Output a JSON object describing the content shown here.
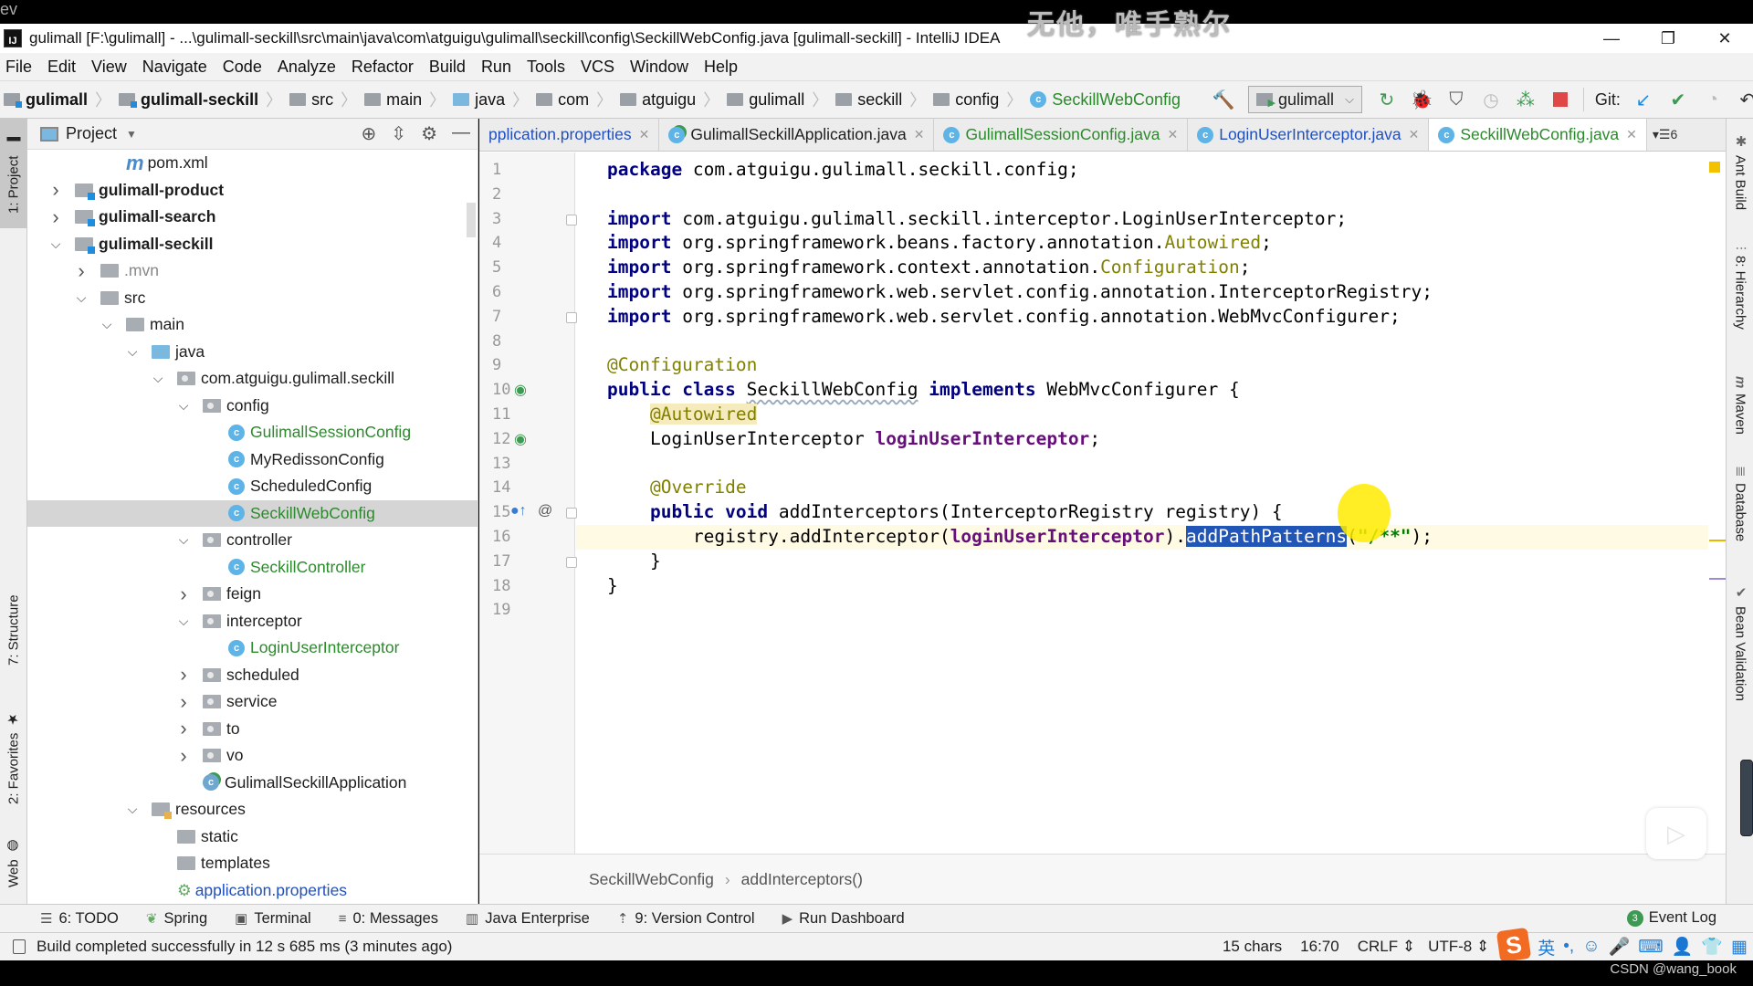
{
  "overlay": {
    "corner_text": "ev",
    "watermark": "无他，唯手熟尔",
    "credit": "CSDN @wang_book"
  },
  "window": {
    "app_icon": "IJ",
    "title": "gulimall [F:\\gulimall] - ...\\gulimall-seckill\\src\\main\\java\\com\\atguigu\\gulimall\\seckill\\config\\SeckillWebConfig.java [gulimall-seckill] - IntelliJ IDEA",
    "controls": {
      "minimize": "—",
      "restore": "❐",
      "close": "✕"
    }
  },
  "menu": [
    "File",
    "Edit",
    "View",
    "Navigate",
    "Code",
    "Analyze",
    "Refactor",
    "Build",
    "Run",
    "Tools",
    "VCS",
    "Window",
    "Help"
  ],
  "navbar": {
    "crumbs": [
      {
        "label": "gulimall",
        "icon": "module-folder",
        "bold": true
      },
      {
        "label": "gulimall-seckill",
        "icon": "module-folder",
        "bold": true
      },
      {
        "label": "src",
        "icon": "folder"
      },
      {
        "label": "main",
        "icon": "folder"
      },
      {
        "label": "java",
        "icon": "source-folder"
      },
      {
        "label": "com",
        "icon": "package"
      },
      {
        "label": "atguigu",
        "icon": "package"
      },
      {
        "label": "gulimall",
        "icon": "package"
      },
      {
        "label": "seckill",
        "icon": "package"
      },
      {
        "label": "config",
        "icon": "package"
      },
      {
        "label": "SeckillWebConfig",
        "icon": "class"
      }
    ],
    "run_config": "gulimall",
    "git_label": "Git:"
  },
  "project_panel": {
    "title": "Project",
    "tree": [
      {
        "label": "pom.xml",
        "depth": 3,
        "icon": "maven",
        "arrow": ""
      },
      {
        "label": "gulimall-product",
        "depth": 1,
        "icon": "module",
        "arrow": "right",
        "bold": true
      },
      {
        "label": "gulimall-search",
        "depth": 1,
        "icon": "module",
        "arrow": "right",
        "bold": true
      },
      {
        "label": "gulimall-seckill",
        "depth": 1,
        "icon": "module",
        "arrow": "down",
        "bold": true
      },
      {
        "label": ".mvn",
        "depth": 2,
        "icon": "folder",
        "arrow": "right",
        "style": "muted"
      },
      {
        "label": "src",
        "depth": 2,
        "icon": "folder",
        "arrow": "down"
      },
      {
        "label": "main",
        "depth": 3,
        "icon": "folder",
        "arrow": "down"
      },
      {
        "label": "java",
        "depth": 4,
        "icon": "source",
        "arrow": "down"
      },
      {
        "label": "com.atguigu.gulimall.seckill",
        "depth": 5,
        "icon": "package",
        "arrow": "down"
      },
      {
        "label": "config",
        "depth": 6,
        "icon": "package",
        "arrow": "down"
      },
      {
        "label": "GulimallSessionConfig",
        "depth": 7,
        "icon": "class",
        "arrow": "",
        "style": "green"
      },
      {
        "label": "MyRedissonConfig",
        "depth": 7,
        "icon": "class",
        "arrow": ""
      },
      {
        "label": "ScheduledConfig",
        "depth": 7,
        "icon": "class",
        "arrow": ""
      },
      {
        "label": "SeckillWebConfig",
        "depth": 7,
        "icon": "class",
        "arrow": "",
        "style": "green",
        "selected": true
      },
      {
        "label": "controller",
        "depth": 6,
        "icon": "package",
        "arrow": "down"
      },
      {
        "label": "SeckillController",
        "depth": 7,
        "icon": "class",
        "arrow": "",
        "style": "green"
      },
      {
        "label": "feign",
        "depth": 6,
        "icon": "package",
        "arrow": "right"
      },
      {
        "label": "interceptor",
        "depth": 6,
        "icon": "package",
        "arrow": "down"
      },
      {
        "label": "LoginUserInterceptor",
        "depth": 7,
        "icon": "class",
        "arrow": "",
        "style": "green"
      },
      {
        "label": "scheduled",
        "depth": 6,
        "icon": "package",
        "arrow": "right"
      },
      {
        "label": "service",
        "depth": 6,
        "icon": "package",
        "arrow": "right"
      },
      {
        "label": "to",
        "depth": 6,
        "icon": "package",
        "arrow": "right"
      },
      {
        "label": "vo",
        "depth": 6,
        "icon": "package",
        "arrow": "right"
      },
      {
        "label": "GulimallSeckillApplication",
        "depth": 6,
        "icon": "spring-class",
        "arrow": ""
      },
      {
        "label": "resources",
        "depth": 4,
        "icon": "resources",
        "arrow": "down"
      },
      {
        "label": "static",
        "depth": 5,
        "icon": "folder",
        "arrow": ""
      },
      {
        "label": "templates",
        "depth": 5,
        "icon": "folder",
        "arrow": ""
      },
      {
        "label": "application.properties",
        "depth": 5,
        "icon": "properties",
        "arrow": "",
        "style": "blue"
      }
    ]
  },
  "left_tool_tabs": [
    "1: Project",
    "7: Structure",
    "2: Favorites",
    "Web"
  ],
  "right_tool_tabs": [
    "Ant Build",
    "8: Hierarchy",
    "Maven",
    "Database",
    "Bean Validation"
  ],
  "editor": {
    "tabs": [
      {
        "label": "pplication.properties",
        "style": "blue",
        "icon": ""
      },
      {
        "label": "GulimallSeckillApplication.java",
        "style": "plain",
        "icon": "spring-class"
      },
      {
        "label": "GulimallSessionConfig.java",
        "style": "green",
        "icon": "class"
      },
      {
        "label": "LoginUserInterceptor.java",
        "style": "blue",
        "icon": "class"
      },
      {
        "label": "SeckillWebConfig.java",
        "style": "green",
        "icon": "class",
        "active": true
      }
    ],
    "more_tabs_count": "6",
    "lines": [
      "package com.atguigu.gulimall.seckill.config;",
      "",
      "import com.atguigu.gulimall.seckill.interceptor.LoginUserInterceptor;",
      "import org.springframework.beans.factory.annotation.Autowired;",
      "import org.springframework.context.annotation.Configuration;",
      "import org.springframework.web.servlet.config.annotation.InterceptorRegistry;",
      "import org.springframework.web.servlet.config.annotation.WebMvcConfigurer;",
      "",
      "@Configuration",
      "public class SeckillWebConfig implements WebMvcConfigurer {",
      "    @Autowired",
      "    LoginUserInterceptor loginUserInterceptor;",
      "",
      "    @Override",
      "    public void addInterceptors(InterceptorRegistry registry) {",
      "        registry.addInterceptor(loginUserInterceptor).addPathPatterns(\"/**\");",
      "    }",
      "}",
      ""
    ],
    "current_line": 16,
    "selection_text": "addPathPatterns",
    "breadcrumb": [
      "SeckillWebConfig",
      "addInterceptors()"
    ]
  },
  "bottom_tools": [
    {
      "label": "6: TODO",
      "icon": "list-icon"
    },
    {
      "label": "Spring",
      "icon": "spring-icon"
    },
    {
      "label": "Terminal",
      "icon": "terminal-icon"
    },
    {
      "label": "0: Messages",
      "icon": "messages-icon"
    },
    {
      "label": "Java Enterprise",
      "icon": "java-ee-icon"
    },
    {
      "label": "9: Version Control",
      "icon": "vcs-icon"
    },
    {
      "label": "Run Dashboard",
      "icon": "run-dashboard-icon"
    }
  ],
  "event_log": {
    "label": "Event Log",
    "count": "3"
  },
  "status": {
    "message": "Build completed successfully in 12 s 685 ms (3 minutes ago)",
    "selection": "15 chars",
    "position": "16:70",
    "line_sep": "CRLF ⇕",
    "encoding": "UTF-8 ⇕"
  },
  "ime": {
    "logo": "S",
    "lang": "英",
    "items": [
      "•,",
      "☺",
      "🎙",
      "⌨",
      "👤",
      "👕",
      "▦"
    ]
  }
}
